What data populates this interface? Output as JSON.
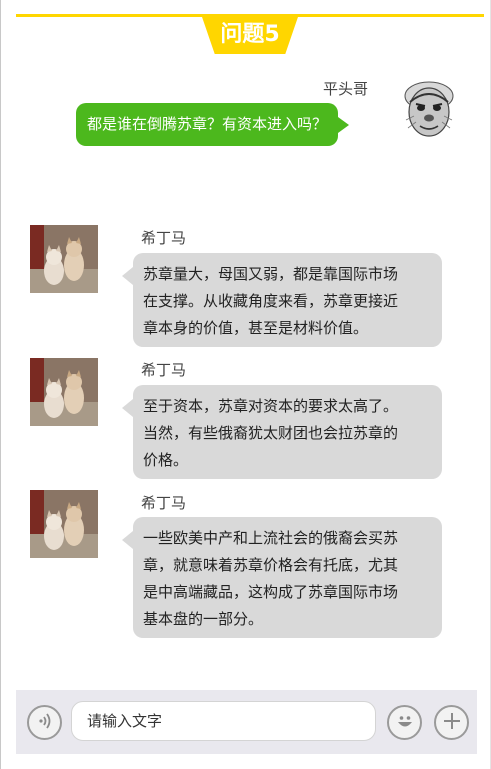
{
  "header": {
    "title": "问题5"
  },
  "messages": [
    {
      "sender": "平头哥",
      "side": "right",
      "text": "都是谁在倒腾苏章？有资本进入吗？"
    },
    {
      "sender": "希丁马",
      "side": "left",
      "lines": [
        "苏章量大，母国又弱，都是靠国际市场",
        "在支撑。从收藏角度来看，苏章更接近",
        "章本身的价值，甚至是材料价值。"
      ]
    },
    {
      "sender": "希丁马",
      "side": "left",
      "lines": [
        "至于资本，苏章对资本的要求太高了。",
        "当然，有些俄裔犹太财团也会拉苏章的",
        "价格。"
      ]
    },
    {
      "sender": "希丁马",
      "side": "left",
      "lines": [
        "一些欧美中产和上流社会的俄裔会买苏",
        "章，就意味着苏章价格会有托底，尤其",
        "是中高端藏品，这构成了苏章国际市场",
        "基本盘的一部分。"
      ]
    }
  ],
  "input_bar": {
    "placeholder": "请输入文字",
    "icons": [
      "voice-icon",
      "emoji-icon",
      "plus-icon"
    ]
  },
  "colors": {
    "accent": "#ffd600",
    "sent_bubble": "#4cb81d",
    "received_bubble": "#d9d9d9",
    "input_bar_bg": "#e9e8ee"
  }
}
